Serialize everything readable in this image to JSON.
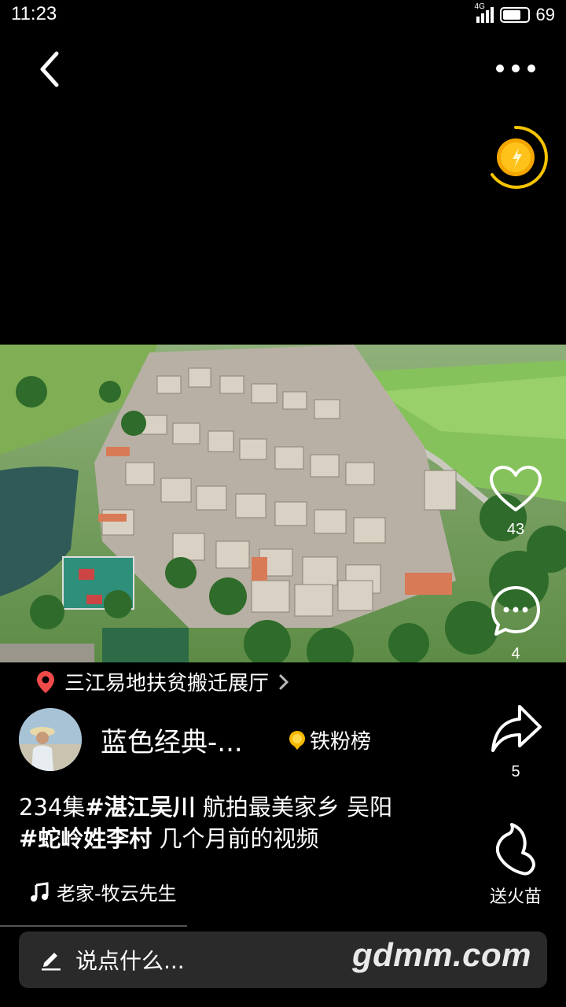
{
  "status_bar": {
    "time": "11:23",
    "network": "4G",
    "battery": "69"
  },
  "location": {
    "label": "三江易地扶贫搬迁展厅"
  },
  "author": {
    "username": "蓝色经典-...",
    "fans_badge": "铁粉榜"
  },
  "caption": {
    "part1": "234集",
    "tag1": "#湛江吴川",
    "part2": " 航拍最美家乡  吴阳",
    "tag2": "#蛇岭姓李村",
    "part3": " 几个月前的视频"
  },
  "music": {
    "label": "老家-牧云先生"
  },
  "actions": {
    "like_count": "43",
    "comment_count": "4",
    "share_count": "5",
    "gift_label": "送火苗"
  },
  "comment_box": {
    "placeholder": "说点什么..."
  },
  "watermark": "gdmm.com",
  "icons": [
    "back-icon",
    "more-icon",
    "coin-icon",
    "heart-icon",
    "comment-icon",
    "share-icon",
    "flame-icon",
    "location-pin-icon",
    "chevron-right-icon",
    "music-note-icon",
    "pencil-icon",
    "fan-medal-icon"
  ]
}
